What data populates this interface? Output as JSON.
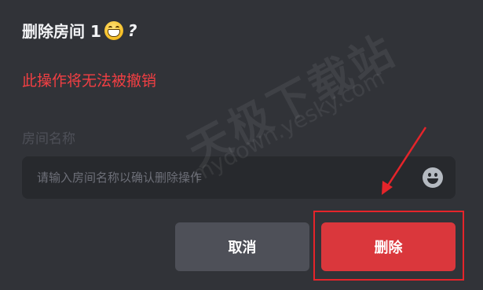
{
  "dialog": {
    "title": "删除房间 1",
    "title_emoji": "grinning-face-emoji",
    "title_suffix": "?",
    "warning": "此操作将无法被撤销",
    "field_label": "房间名称",
    "input": {
      "value": "",
      "placeholder": "请输入房间名称以确认删除操作",
      "emoji_icon": "smiley-icon"
    },
    "cancel_label": "取消",
    "delete_label": "删除"
  },
  "annotation": {
    "highlight_color": "#e5242a"
  },
  "watermark": {
    "main_text": "天极下载站",
    "url_text": "mydown.yesky.com"
  },
  "colors": {
    "background": "#313338",
    "input_bg": "#27292d",
    "warning": "#f23f43",
    "cancel_bg": "#4e5058",
    "delete_bg": "#da373c"
  }
}
